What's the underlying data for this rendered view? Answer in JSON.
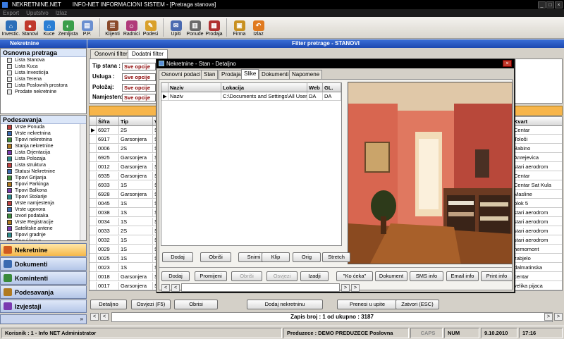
{
  "app": {
    "title": "NEKRETNINE.NET",
    "subtitle": "INFO-NET INFORMACIONI SISTEM - [Pretraga stanova]"
  },
  "menu": [
    "Export",
    "Uputstvo",
    "Izlaz"
  ],
  "toolbar": [
    {
      "label": "Investic.",
      "icon": "investments-icon",
      "color": "#2d6fb8"
    },
    {
      "label": "Stanovi",
      "icon": "apartments-icon",
      "color": "#c0392b"
    },
    {
      "label": "Kuce",
      "icon": "house-icon",
      "color": "#2b7fd4"
    },
    {
      "label": "Zemljista",
      "icon": "land-icon",
      "color": "#3b9e4a"
    },
    {
      "label": "P.P.",
      "icon": "business-space-icon",
      "color": "#6a8fd0"
    },
    {
      "label": "Klijenti",
      "icon": "clients-icon",
      "color": "#8a4a2a"
    },
    {
      "label": "Radnici",
      "icon": "workers-icon",
      "color": "#b03a7a"
    },
    {
      "label": "Podesi",
      "icon": "settings-icon",
      "color": "#d9a02a"
    },
    {
      "label": "Upiti",
      "icon": "inquiries-icon",
      "color": "#4a6ab0"
    },
    {
      "label": "Ponude",
      "icon": "offers-icon",
      "color": "#6a6a6a"
    },
    {
      "label": "Prodaja",
      "icon": "sales-icon",
      "color": "#b03030"
    },
    {
      "label": "Firma",
      "icon": "company-icon",
      "color": "#c89020"
    },
    {
      "label": "Izlaz",
      "icon": "exit-icon",
      "color": "#e07a20"
    }
  ],
  "sidebar": {
    "header": "Nekretnine",
    "section1": "Osnovna pretraga",
    "items1": [
      "Lista Stanova",
      "Lista Kuca",
      "Lista Investicija",
      "Lista Terena",
      "Lista Poslovnih prostora",
      "Prodate nekretnine"
    ],
    "section2": "Podesavanja",
    "items2": [
      "Vrste Ponuda",
      "Vrste nekretnina",
      "Tipovi nekretnina",
      "Stanja nekretnine",
      "Lista Orjentacija",
      "Lista Polozaja",
      "Lista struktura",
      "Statusi Nekretnine",
      "Tipovi Grijanja",
      "Tipovi Parkinga",
      "Tipovi Balkona",
      "Tipovi Stolarije",
      "Vrste namjestenja",
      "Vrste ugovora",
      "Izvori podataka",
      "Vrste Registracije",
      "Satelitske antene",
      "Tipovi gradnje",
      "Tipovi krova"
    ],
    "nav": [
      "Nekretnine",
      "Dokumenti",
      "Komintenti",
      "Podesavanja",
      "Izvjestaji"
    ]
  },
  "main": {
    "header": "Filter pretrage - STANOVI",
    "tabs": [
      "Osnovni filter",
      "Dodatni filter"
    ],
    "filters": [
      {
        "label": "Tip stana :",
        "value": "Sve opcije"
      },
      {
        "label": "Usluga :",
        "value": "Sve opcije"
      },
      {
        "label": "Položaj:",
        "value": "Sve opcije"
      },
      {
        "label": "Namjesten:",
        "value": "Sve opcije"
      }
    ],
    "columns": [
      "Šifra",
      "Tip",
      "V",
      "Kvart"
    ],
    "rows": [
      {
        "sifra": "6927",
        "tip": "2S",
        "v": "S",
        "k": "ora",
        "kvart": "Centar"
      },
      {
        "sifra": "6917",
        "tip": "Garsonjera",
        "v": "S",
        "k": "ora",
        "kvart": "Tološi"
      },
      {
        "sifra": "0006",
        "tip": "2S",
        "v": "S",
        "k": "",
        "kvart": "Babino"
      },
      {
        "sifra": "6925",
        "tip": "Garsonjera",
        "v": "S",
        "k": "",
        "kvart": "Anrejevica"
      },
      {
        "sifra": "0012",
        "tip": "Garsonjera",
        "v": "S",
        "k": "ora",
        "kvart": "stari aerodrom"
      },
      {
        "sifra": "6935",
        "tip": "Garsonjera",
        "v": "S",
        "k": "ora",
        "kvart": "Centar"
      },
      {
        "sifra": "6933",
        "tip": "1S",
        "v": "S",
        "k": "ora",
        "kvart": "Centar Sat Kula"
      },
      {
        "sifra": "6928",
        "tip": "Garsonjera",
        "v": "S",
        "k": "ora",
        "kvart": "Masline"
      },
      {
        "sifra": "0045",
        "tip": "1S",
        "v": "S",
        "k": "",
        "kvart": "blok 5"
      },
      {
        "sifra": "0038",
        "tip": "1S",
        "v": "S",
        "k": "ora",
        "kvart": "stari aerodrom"
      },
      {
        "sifra": "0034",
        "tip": "1S",
        "v": "S",
        "k": "ora",
        "kvart": "stari aerodrom"
      },
      {
        "sifra": "0033",
        "tip": "2S",
        "v": "S",
        "k": "ora",
        "kvart": "stari aerodrom"
      },
      {
        "sifra": "0032",
        "tip": "1S",
        "v": "S",
        "k": "ora",
        "kvart": "stari aerodrom"
      },
      {
        "sifra": "0029",
        "tip": "1S",
        "v": "S",
        "k": "",
        "kvart": "hemomont"
      },
      {
        "sifra": "0025",
        "tip": "1S",
        "v": "S",
        "k": "",
        "kvart": "zabjelo"
      },
      {
        "sifra": "0023",
        "tip": "1S",
        "v": "S",
        "k": "",
        "kvart": "dalmatinska"
      },
      {
        "sifra": "0018",
        "tip": "Garsonjera",
        "v": "S",
        "k": "",
        "kvart": "centar"
      },
      {
        "sifra": "0017",
        "tip": "Garsonjera",
        "v": "S",
        "k": "",
        "kvart": "velika pijaca"
      }
    ],
    "buttons": [
      "Detaljno",
      "Osvjezi (F5)",
      "Obrisi",
      "Dodaj nekretninu",
      "Prenesi u upite",
      "Zatvori (ESC)"
    ],
    "record": "Zapis broj : 1 od ukupno : 3187"
  },
  "dialog": {
    "title": "Nekretnine - Stan - Detaljno",
    "tabs": [
      "Osnovni podaci",
      "Stan",
      "Prodaja",
      "Slike",
      "Dokumenti",
      "Napomene"
    ],
    "grid_cols": [
      "Naziv",
      "Lokacija",
      "Web",
      "GL."
    ],
    "grid_row": {
      "naziv": "Naziv",
      "lokacija": "C:\\Documents and Settings\\All Users",
      "web": "DA",
      "gl": "DA"
    },
    "img_buttons": [
      "Dodaj",
      "Obriši",
      "Snimi",
      "Klip",
      "Orig",
      "Stretch"
    ],
    "bottom_buttons": [
      "Dodaj",
      "Promijeni",
      "Obriši",
      "Osvjezi",
      "Izadji",
      "\"Ko ćeka\"",
      "Dokument",
      "SMS info",
      "Email info",
      "Print info"
    ]
  },
  "status": {
    "user": "Korisnik : 1 - Info NET  Administrator",
    "company": "Preduzece : DEMO PREDUZECE  Poslovna Godina :2010",
    "caps": "CAPS",
    "num": "NUM",
    "date": "9.10.2010",
    "time": "17:16"
  }
}
